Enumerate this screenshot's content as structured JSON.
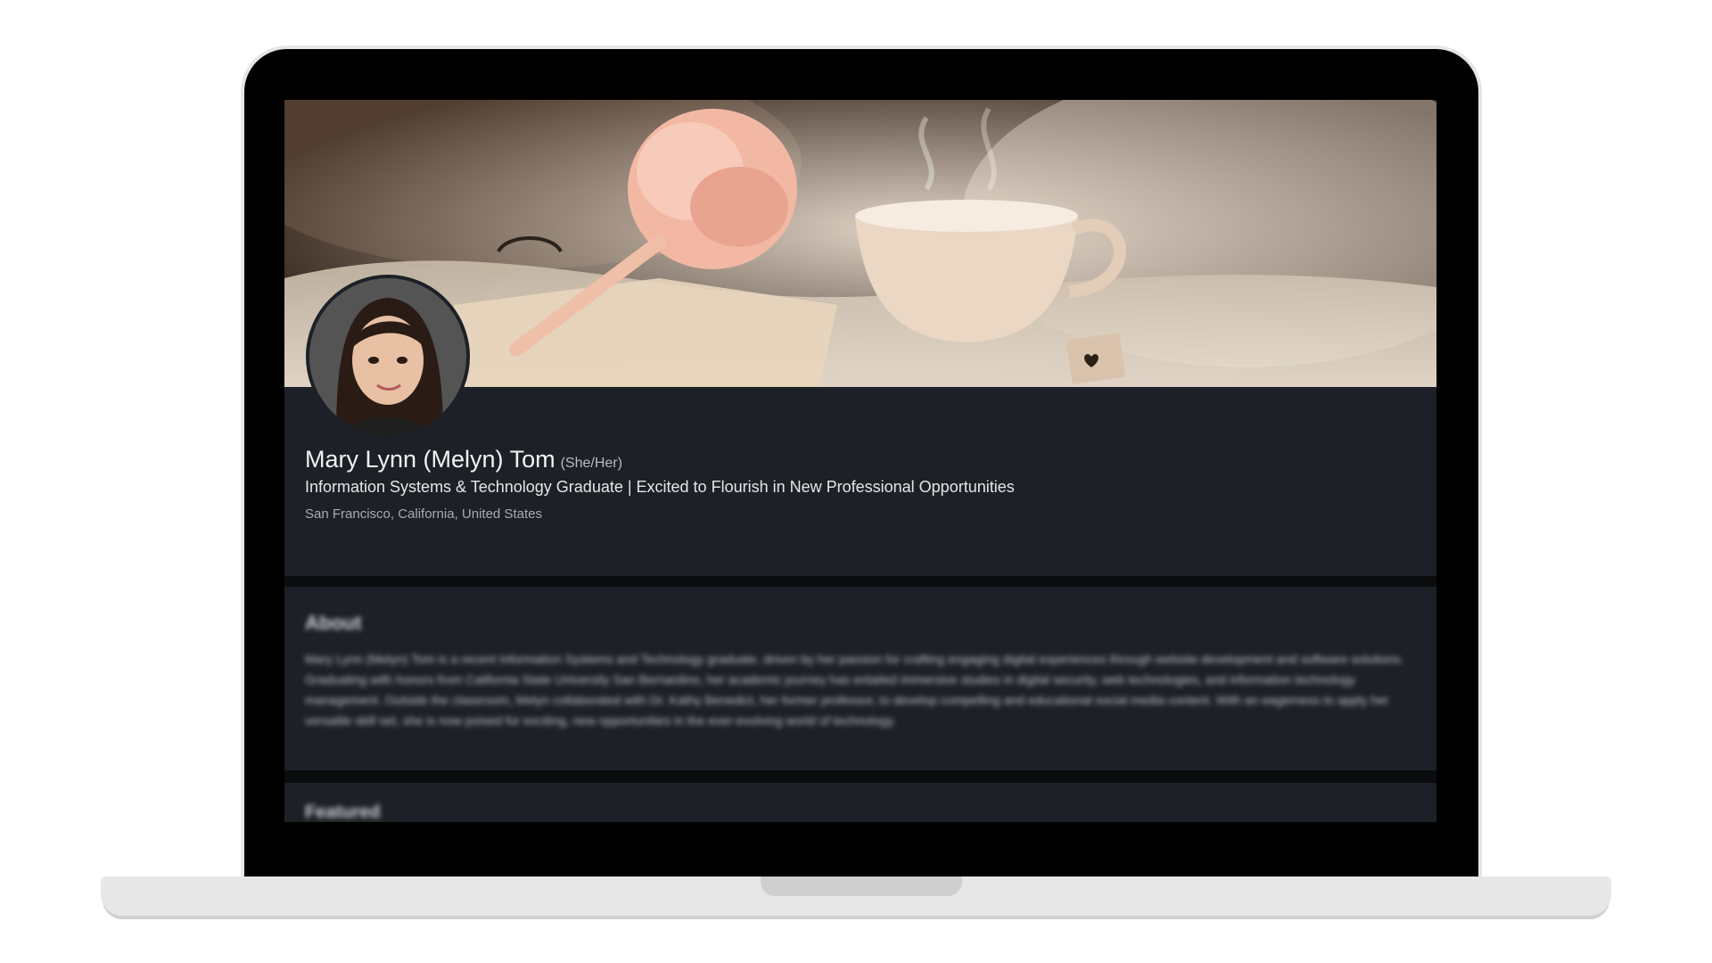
{
  "profile": {
    "name": "Mary Lynn (Melyn) Tom",
    "pronouns": "(She/Her)",
    "headline": "Information Systems & Technology Graduate | Excited to Flourish in New Professional Opportunities",
    "location": "San Francisco, California, United States"
  },
  "about": {
    "title": "About",
    "text": "Mary Lynn (Melyn) Tom is a recent Information Systems and Technology graduate, driven by her passion for crafting engaging digital experiences through website development and software solutions. Graduating with honors from California State University San Bernardino, her academic journey has entailed immersive studies in digital security, web technologies, and information technology management. Outside the classroom, Melyn collaborated with Dr. Kathy Benedict, her former professor, to develop compelling and educational social media content. With an eagerness to apply her versatile skill set, she is now poised for exciting, new opportunities in the ever-evolving world of technology."
  },
  "featured": {
    "title": "Featured"
  },
  "icons": {
    "banner": "banner-image-teacup",
    "avatar": "profile-photo"
  },
  "colors": {
    "card_bg": "#1d2026",
    "screen_bg": "#0b0c0e",
    "text_primary": "#f2f2f2"
  }
}
